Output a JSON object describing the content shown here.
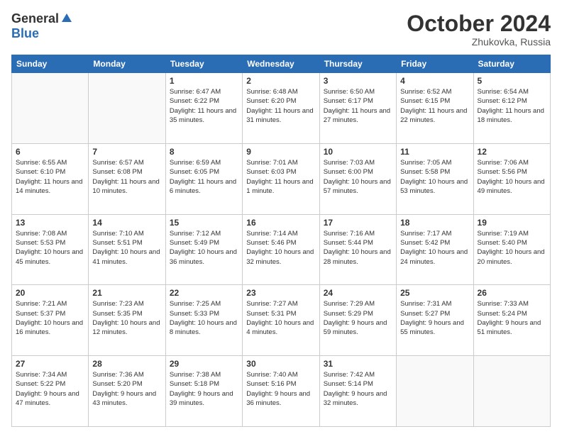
{
  "logo": {
    "general": "General",
    "blue": "Blue"
  },
  "title": {
    "month_year": "October 2024",
    "location": "Zhukovka, Russia"
  },
  "weekdays": [
    "Sunday",
    "Monday",
    "Tuesday",
    "Wednesday",
    "Thursday",
    "Friday",
    "Saturday"
  ],
  "weeks": [
    [
      {
        "day": "",
        "info": ""
      },
      {
        "day": "",
        "info": ""
      },
      {
        "day": "1",
        "info": "Sunrise: 6:47 AM\nSunset: 6:22 PM\nDaylight: 11 hours\nand 35 minutes."
      },
      {
        "day": "2",
        "info": "Sunrise: 6:48 AM\nSunset: 6:20 PM\nDaylight: 11 hours\nand 31 minutes."
      },
      {
        "day": "3",
        "info": "Sunrise: 6:50 AM\nSunset: 6:17 PM\nDaylight: 11 hours\nand 27 minutes."
      },
      {
        "day": "4",
        "info": "Sunrise: 6:52 AM\nSunset: 6:15 PM\nDaylight: 11 hours\nand 22 minutes."
      },
      {
        "day": "5",
        "info": "Sunrise: 6:54 AM\nSunset: 6:12 PM\nDaylight: 11 hours\nand 18 minutes."
      }
    ],
    [
      {
        "day": "6",
        "info": "Sunrise: 6:55 AM\nSunset: 6:10 PM\nDaylight: 11 hours\nand 14 minutes."
      },
      {
        "day": "7",
        "info": "Sunrise: 6:57 AM\nSunset: 6:08 PM\nDaylight: 11 hours\nand 10 minutes."
      },
      {
        "day": "8",
        "info": "Sunrise: 6:59 AM\nSunset: 6:05 PM\nDaylight: 11 hours\nand 6 minutes."
      },
      {
        "day": "9",
        "info": "Sunrise: 7:01 AM\nSunset: 6:03 PM\nDaylight: 11 hours\nand 1 minute."
      },
      {
        "day": "10",
        "info": "Sunrise: 7:03 AM\nSunset: 6:00 PM\nDaylight: 10 hours\nand 57 minutes."
      },
      {
        "day": "11",
        "info": "Sunrise: 7:05 AM\nSunset: 5:58 PM\nDaylight: 10 hours\nand 53 minutes."
      },
      {
        "day": "12",
        "info": "Sunrise: 7:06 AM\nSunset: 5:56 PM\nDaylight: 10 hours\nand 49 minutes."
      }
    ],
    [
      {
        "day": "13",
        "info": "Sunrise: 7:08 AM\nSunset: 5:53 PM\nDaylight: 10 hours\nand 45 minutes."
      },
      {
        "day": "14",
        "info": "Sunrise: 7:10 AM\nSunset: 5:51 PM\nDaylight: 10 hours\nand 41 minutes."
      },
      {
        "day": "15",
        "info": "Sunrise: 7:12 AM\nSunset: 5:49 PM\nDaylight: 10 hours\nand 36 minutes."
      },
      {
        "day": "16",
        "info": "Sunrise: 7:14 AM\nSunset: 5:46 PM\nDaylight: 10 hours\nand 32 minutes."
      },
      {
        "day": "17",
        "info": "Sunrise: 7:16 AM\nSunset: 5:44 PM\nDaylight: 10 hours\nand 28 minutes."
      },
      {
        "day": "18",
        "info": "Sunrise: 7:17 AM\nSunset: 5:42 PM\nDaylight: 10 hours\nand 24 minutes."
      },
      {
        "day": "19",
        "info": "Sunrise: 7:19 AM\nSunset: 5:40 PM\nDaylight: 10 hours\nand 20 minutes."
      }
    ],
    [
      {
        "day": "20",
        "info": "Sunrise: 7:21 AM\nSunset: 5:37 PM\nDaylight: 10 hours\nand 16 minutes."
      },
      {
        "day": "21",
        "info": "Sunrise: 7:23 AM\nSunset: 5:35 PM\nDaylight: 10 hours\nand 12 minutes."
      },
      {
        "day": "22",
        "info": "Sunrise: 7:25 AM\nSunset: 5:33 PM\nDaylight: 10 hours\nand 8 minutes."
      },
      {
        "day": "23",
        "info": "Sunrise: 7:27 AM\nSunset: 5:31 PM\nDaylight: 10 hours\nand 4 minutes."
      },
      {
        "day": "24",
        "info": "Sunrise: 7:29 AM\nSunset: 5:29 PM\nDaylight: 9 hours\nand 59 minutes."
      },
      {
        "day": "25",
        "info": "Sunrise: 7:31 AM\nSunset: 5:27 PM\nDaylight: 9 hours\nand 55 minutes."
      },
      {
        "day": "26",
        "info": "Sunrise: 7:33 AM\nSunset: 5:24 PM\nDaylight: 9 hours\nand 51 minutes."
      }
    ],
    [
      {
        "day": "27",
        "info": "Sunrise: 7:34 AM\nSunset: 5:22 PM\nDaylight: 9 hours\nand 47 minutes."
      },
      {
        "day": "28",
        "info": "Sunrise: 7:36 AM\nSunset: 5:20 PM\nDaylight: 9 hours\nand 43 minutes."
      },
      {
        "day": "29",
        "info": "Sunrise: 7:38 AM\nSunset: 5:18 PM\nDaylight: 9 hours\nand 39 minutes."
      },
      {
        "day": "30",
        "info": "Sunrise: 7:40 AM\nSunset: 5:16 PM\nDaylight: 9 hours\nand 36 minutes."
      },
      {
        "day": "31",
        "info": "Sunrise: 7:42 AM\nSunset: 5:14 PM\nDaylight: 9 hours\nand 32 minutes."
      },
      {
        "day": "",
        "info": ""
      },
      {
        "day": "",
        "info": ""
      }
    ]
  ]
}
